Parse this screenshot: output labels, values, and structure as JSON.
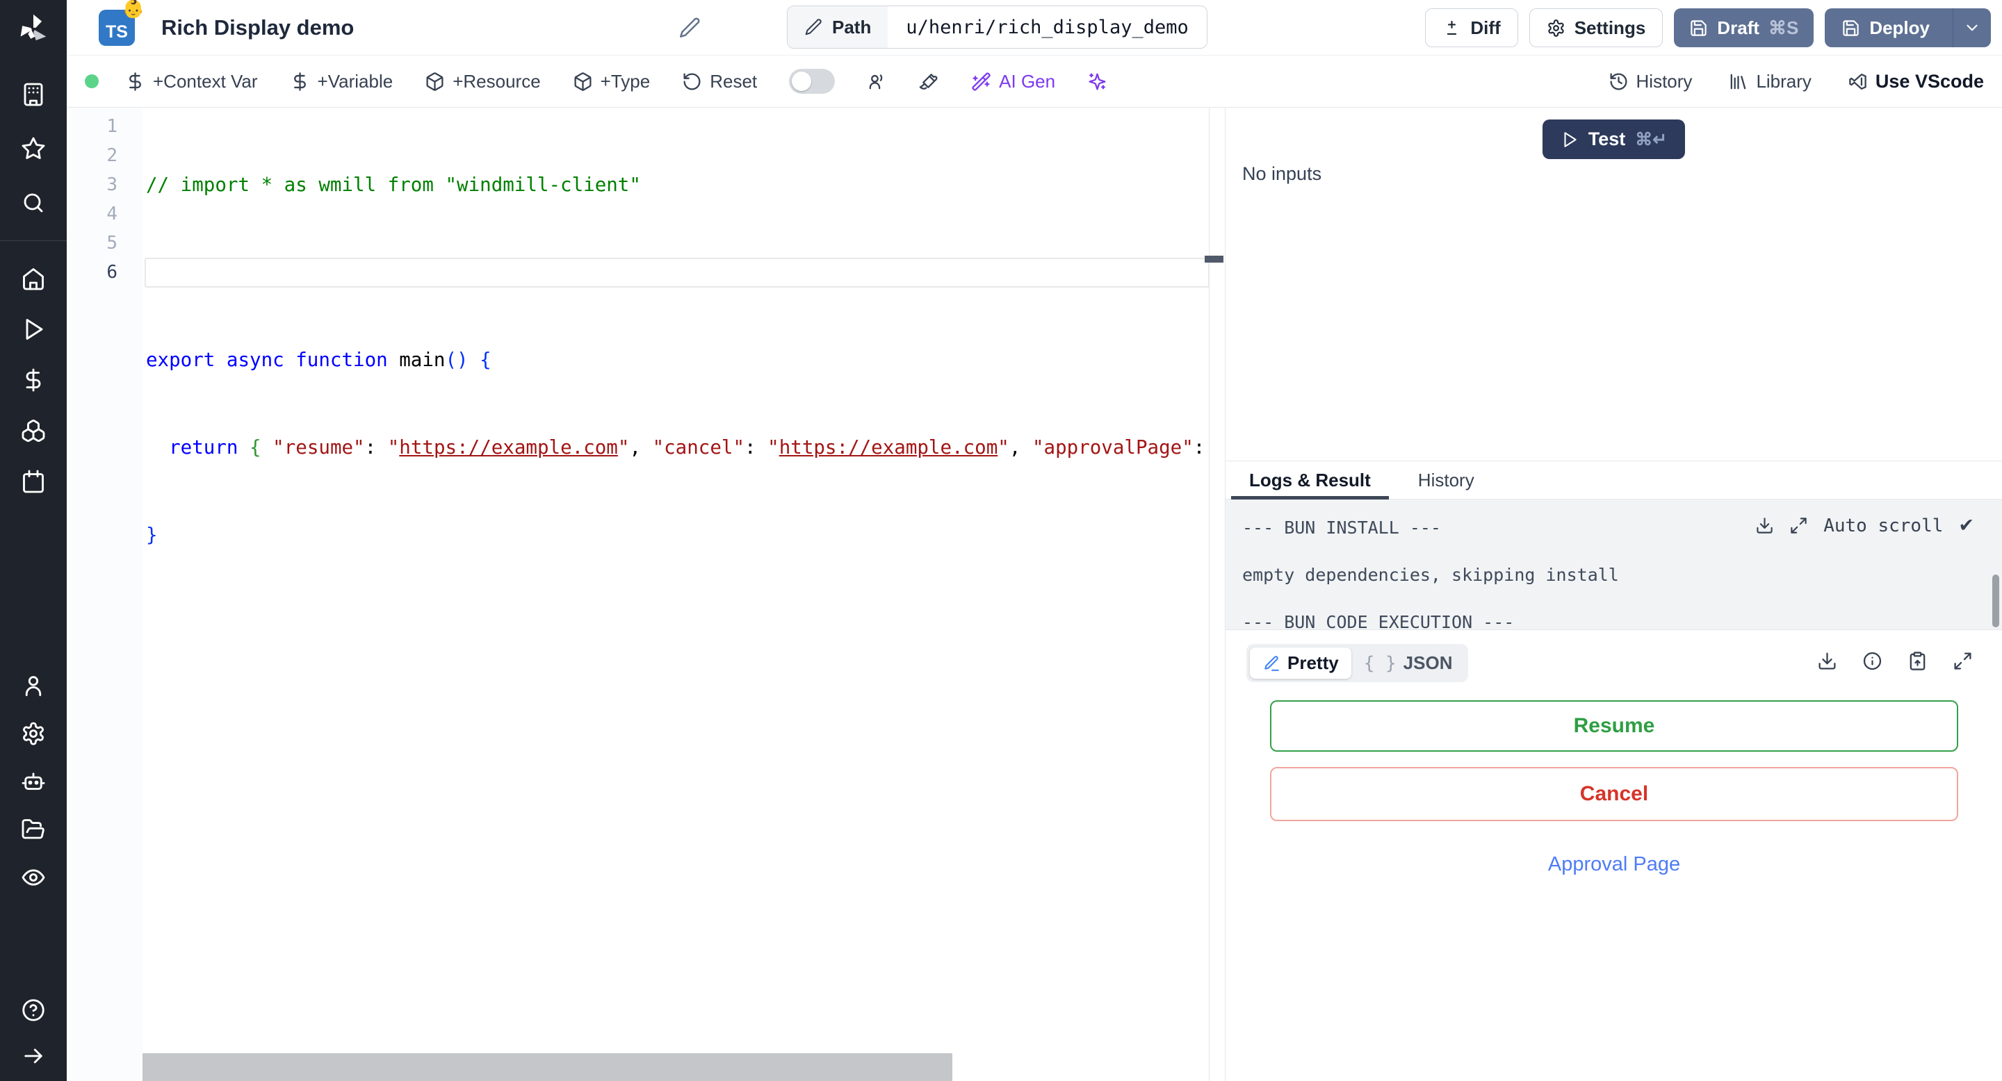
{
  "colors": {
    "sidebar_bg": "#1f232b",
    "ts_badge_blue": "#3178c6",
    "primary_button": "#5e7194",
    "test_button": "#2d3a5c",
    "status_dot_green": "#5bd389",
    "ai_purple": "#7c3aed",
    "resume_green": "#34a04a",
    "cancel_red": "#d6342a",
    "cancel_border": "#f2a69e",
    "link_blue": "#4e7cf7",
    "code_comment": "#008000",
    "code_keyword": "#0000ff",
    "code_string": "#a31515",
    "code_bracket_l1": "#0431fa",
    "code_bracket_l2": "#319331"
  },
  "sidebar": {
    "icons": [
      "windmill-logo",
      "building",
      "star",
      "search",
      "home",
      "play",
      "dollar",
      "boxes",
      "calendar",
      "user",
      "gear",
      "bot",
      "folder-open",
      "eye",
      "help",
      "arrow-right"
    ]
  },
  "header": {
    "language_badge": "TS",
    "badge_emoji": "👶",
    "title": "Rich Display demo",
    "path_label": "Path",
    "path_value": "u/henri/rich_display_demo",
    "diff_label": "Diff",
    "settings_label": "Settings",
    "draft_label": "Draft",
    "draft_shortcut": "⌘S",
    "deploy_label": "Deploy"
  },
  "toolbar": {
    "context_var": "+Context Var",
    "variable": "+Variable",
    "resource": "+Resource",
    "type": "+Type",
    "reset": "Reset",
    "ai_gen": "AI Gen",
    "history": "History",
    "library": "Library",
    "vscode": "Use VScode"
  },
  "editor": {
    "line_numbers": [
      "1",
      "2",
      "3",
      "4",
      "5",
      "6"
    ],
    "code": {
      "1": [
        {
          "c": "comment",
          "t": "// import * as wmill from \"windmill-client\""
        }
      ],
      "2": [],
      "3": [
        {
          "c": "keyword",
          "t": "export async function "
        },
        {
          "c": "plain",
          "t": "main"
        },
        {
          "c": "bracket1",
          "t": "() {"
        }
      ],
      "4": [
        {
          "c": "plain",
          "t": "  "
        },
        {
          "c": "keyword",
          "t": "return"
        },
        {
          "c": "plain",
          "t": " "
        },
        {
          "c": "bracket2",
          "t": "{"
        },
        {
          "c": "plain",
          "t": " "
        },
        {
          "c": "string",
          "t": "\"resume\""
        },
        {
          "c": "plain",
          "t": ": "
        },
        {
          "c": "string",
          "t": "\""
        },
        {
          "c": "link",
          "t": "https://example.com"
        },
        {
          "c": "string",
          "t": "\""
        },
        {
          "c": "plain",
          "t": ", "
        },
        {
          "c": "string",
          "t": "\"cancel\""
        },
        {
          "c": "plain",
          "t": ": "
        },
        {
          "c": "string",
          "t": "\""
        },
        {
          "c": "link",
          "t": "https://example.com"
        },
        {
          "c": "string",
          "t": "\""
        },
        {
          "c": "plain",
          "t": ", "
        },
        {
          "c": "string",
          "t": "\"approvalPage\""
        },
        {
          "c": "plain",
          "t": ":"
        }
      ],
      "5": [
        {
          "c": "bracket1",
          "t": "}"
        }
      ],
      "6": []
    }
  },
  "run": {
    "test_label": "Test",
    "test_shortcut": "⌘↵",
    "no_inputs": "No inputs"
  },
  "logs": {
    "tab_logs": "Logs & Result",
    "tab_history": "History",
    "lines": [
      "--- BUN INSTALL ---",
      "empty dependencies, skipping install",
      "--- BUN CODE EXECUTION ---"
    ],
    "auto_scroll": "Auto scroll",
    "auto_scroll_check": "✔"
  },
  "result": {
    "pretty_label": "Pretty",
    "json_label": "JSON",
    "json_braces": "{ }",
    "resume_label": "Resume",
    "cancel_label": "Cancel",
    "approval_label": "Approval Page"
  }
}
